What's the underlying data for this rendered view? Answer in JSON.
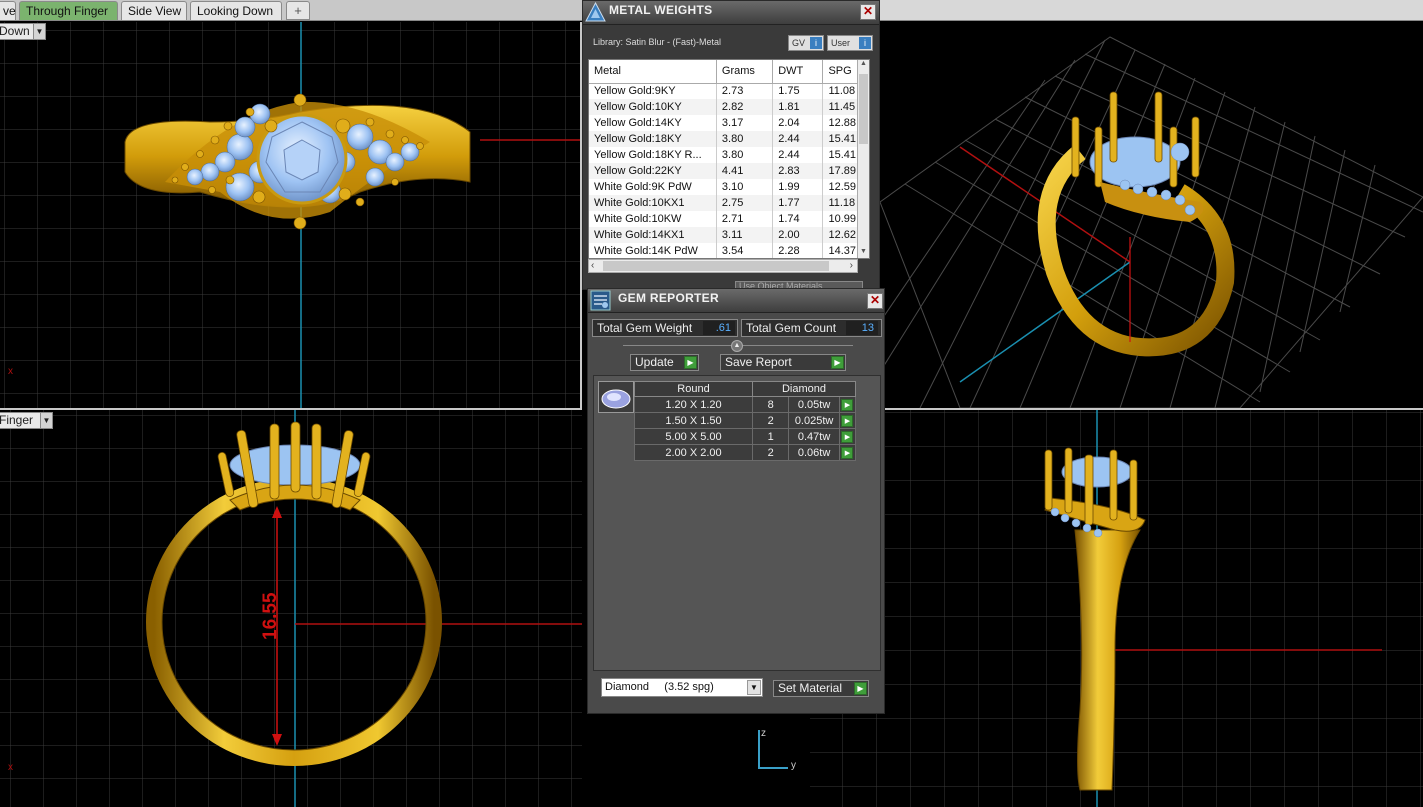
{
  "tabs": [
    {
      "label": "ve"
    },
    {
      "label": "Through Finger"
    },
    {
      "label": "Side View"
    },
    {
      "label": "Looking Down"
    }
  ],
  "tab_add_label": "+",
  "viewports": {
    "top_left_view": "Down",
    "bottom_left_view": "Finger",
    "dimension_label": "16.55",
    "axis_z": "z",
    "axis_y": "y",
    "axis_x": "x"
  },
  "metal_weights": {
    "title": "METAL WEIGHTS",
    "library": "Library: Satin Blur - (Fast)-Metal",
    "btn_gv": "GV",
    "btn_user": "User",
    "columns": [
      "Metal",
      "Grams",
      "DWT",
      "SPG"
    ],
    "rows": [
      [
        "Yellow Gold:9KY",
        "2.73",
        "1.75",
        "11.08"
      ],
      [
        "Yellow Gold:10KY",
        "2.82",
        "1.81",
        "11.45"
      ],
      [
        "Yellow Gold:14KY",
        "3.17",
        "2.04",
        "12.88"
      ],
      [
        "Yellow Gold:18KY",
        "3.80",
        "2.44",
        "15.41"
      ],
      [
        "Yellow Gold:18KY R...",
        "3.80",
        "2.44",
        "15.41"
      ],
      [
        "Yellow Gold:22KY",
        "4.41",
        "2.83",
        "17.89"
      ],
      [
        "White Gold:9K PdW",
        "3.10",
        "1.99",
        "12.59"
      ],
      [
        "White Gold:10KX1",
        "2.75",
        "1.77",
        "11.18"
      ],
      [
        "White Gold:10KW",
        "2.71",
        "1.74",
        "10.99"
      ],
      [
        "White Gold:14KX1",
        "3.11",
        "2.00",
        "12.62"
      ],
      [
        "White Gold:14K PdW",
        "3.54",
        "2.28",
        "14.37"
      ]
    ],
    "hidden_field": "Use Object Materials"
  },
  "gem_reporter": {
    "title": "GEM REPORTER",
    "total_weight_label": "Total Gem Weight",
    "total_weight_value": ".61",
    "total_count_label": "Total Gem Count",
    "total_count_value": "13",
    "update_label": "Update",
    "save_report_label": "Save Report",
    "shape_header": "Round",
    "material_header": "Diamond",
    "gems": [
      {
        "size": "1.20 X 1.20",
        "count": "8",
        "weight": "0.05tw"
      },
      {
        "size": "1.50 X 1.50",
        "count": "2",
        "weight": "0.025tw"
      },
      {
        "size": "5.00 X 5.00",
        "count": "1",
        "weight": "0.47tw"
      },
      {
        "size": "2.00 X 2.00",
        "count": "2",
        "weight": "0.06tw"
      }
    ],
    "material_select": "Diamond     (3.52 spg)",
    "set_material_label": "Set Material"
  },
  "colors": {
    "gold": "#d9a514",
    "gem": "#9cc4f2",
    "grid": "#3c3c3c",
    "axis_red": "#b01010",
    "axis_blue": "#1a8fb0",
    "accent_green": "#3f9e3a"
  }
}
